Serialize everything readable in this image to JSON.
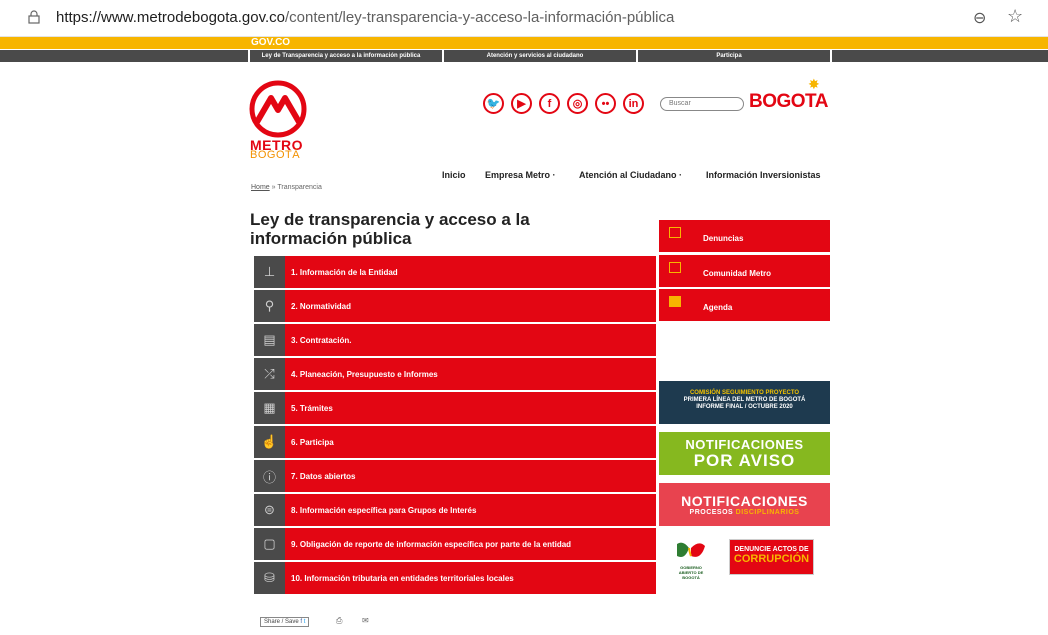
{
  "browser": {
    "url_domain": "https://www.metrodebogota.gov.co",
    "url_path": "/content/ley-transparencia-y-acceso-la-información-pública"
  },
  "gov": {
    "logo": "GOV.CO"
  },
  "topnav": [
    "Ley de Transparencia y acceso a la información pública",
    "Atención y servicios al ciudadano",
    "Participa"
  ],
  "header": {
    "logo_line1": "METRO",
    "logo_line2": "BOGOTÁ",
    "search_placeholder": "Buscar",
    "bogota": "BOGOTA"
  },
  "mainnav": {
    "inicio": "Inicio",
    "empresa": "Empresa Metro",
    "atencion": "Atención al Ciudadano",
    "inversionistas": "Información Inversionistas"
  },
  "breadcrumb": {
    "home": "Home",
    "sep": "»",
    "current": "Transparencia"
  },
  "page_title": "Ley de transparencia y acceso a la información pública",
  "list": [
    {
      "icon": "org-chart-icon",
      "label": "1. Información de la Entidad"
    },
    {
      "icon": "gavel-icon",
      "label": "2. Normatividad"
    },
    {
      "icon": "document-icon",
      "label": "3. Contratación."
    },
    {
      "icon": "planning-icon",
      "label": "4. Planeación, Presupuesto e Informes"
    },
    {
      "icon": "forms-icon",
      "label": "5. Trámites"
    },
    {
      "icon": "hand-icon",
      "label": "6. Participa"
    },
    {
      "icon": "info-icon",
      "label": "7. Datos abiertos"
    },
    {
      "icon": "chat-icon",
      "label": "8. Información específica para Grupos de Interés"
    },
    {
      "icon": "clipboard-icon",
      "label": "9. Obligación de reporte de información específica por parte de la entidad"
    },
    {
      "icon": "coins-icon",
      "label": "10. Información tributaria en entidades territoriales locales"
    }
  ],
  "side": {
    "denuncias": "Denuncias",
    "comunidad": "Comunidad Metro",
    "agenda": "Agenda"
  },
  "banners": {
    "comision_l1": "COMISIÓN SEGUIMIENTO PROYECTO",
    "comision_l2": "PRIMERA LÍNEA DEL METRO DE BOGOTÁ",
    "comision_l3": "INFORME FINAL / OCTUBRE 2020",
    "notif_aviso_l1": "NOTIFICACIONES",
    "notif_aviso_l2": "POR AVISO",
    "notif_proc_l1": "NOTIFICACIONES",
    "notif_proc_l2a": "PROCESOS",
    "notif_proc_l2b": "DISCIPLINARIOS",
    "gobierno": "GOBIERNO ABIERTO DE BOGOTÁ",
    "denuncie_l1": "DENUNCIE ACTOS DE",
    "denuncie_l2": "CORRUPCIÓN"
  },
  "share": {
    "label": "Share / Save"
  }
}
